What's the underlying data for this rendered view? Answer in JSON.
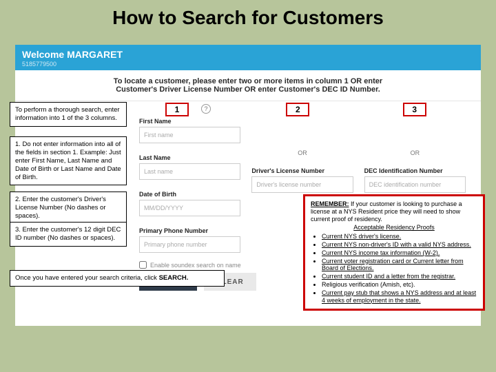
{
  "title": "How to Search for Customers",
  "welcome": {
    "prefix": "Welcome ",
    "name": "MARGARET",
    "id": "5185779500"
  },
  "instruction": "To locate a customer, please enter two or more items in column 1 OR enter Customer's Driver License Number OR enter Customer's DEC ID Number.",
  "badges": {
    "b1": "1",
    "b2": "2",
    "b3": "3"
  },
  "help": "?",
  "col1": {
    "firstNameLabel": "First Name",
    "firstNamePh": "First name",
    "lastNameLabel": "Last Name",
    "lastNamePh": "Last name",
    "dobLabel": "Date of Birth",
    "dobPh": "MM/DD/YYYY",
    "phoneLabel": "Primary Phone Number",
    "phonePh": "Primary phone number"
  },
  "col2": {
    "or": "OR",
    "dlLabel": "Driver's License Number",
    "dlPh": "Driver's license number"
  },
  "col3": {
    "or": "OR",
    "decLabel": "DEC Identification Number",
    "decPh": "DEC identification number"
  },
  "soundex": "Enable soundex search on name",
  "buttons": {
    "search": "SEARCH",
    "clear": "CLEAR"
  },
  "callouts": {
    "intro": "To perform a thorough search, enter information into 1 of the 3 columns.",
    "one": "1. Do not enter information into all of the fields in section 1. Example: Just enter First Name, Last Name and Date of Birth or Last Name and Date of Birth.",
    "two": "2. Enter the customer's Driver's License Number (No dashes or spaces).",
    "three": "3. Enter the customer's 12 digit DEC ID number (No dashes or spaces).",
    "bottom_a": "Once you have entered your search criteria, click ",
    "bottom_b": "SEARCH."
  },
  "remember": {
    "hdr": "REMEMBER:",
    "lead": " If your customer is looking to purchase a license at a NYS Resident price they will need to show current proof of residency.",
    "sub": "Acceptable Residency Proofs",
    "items": [
      "Current NYS driver's license.",
      "Current NYS non-driver's ID with a valid NYS address.",
      "Current NYS income tax information (W-2).",
      "Current voter registration card or Current letter from Board of Elections.",
      "Current student ID and a letter from the registrar.",
      "Religious verification (Amish, etc).",
      "Current pay stub that shows a NYS address and at least 4 weeks of employment in the state."
    ]
  }
}
